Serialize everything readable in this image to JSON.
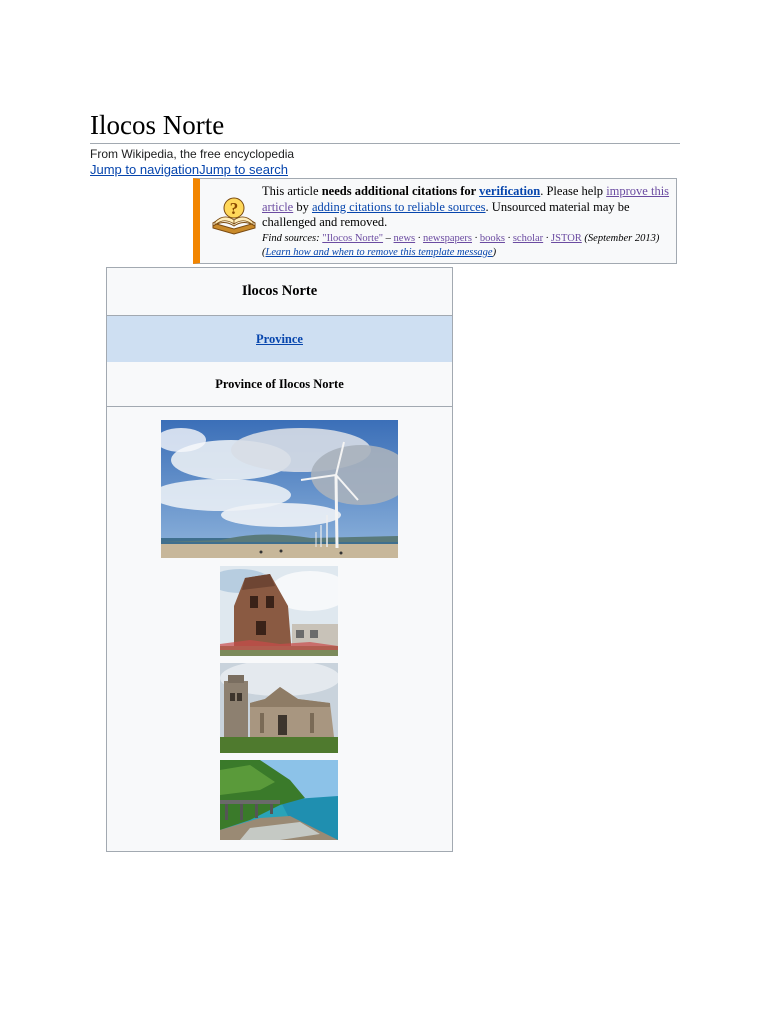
{
  "article": {
    "title": "Ilocos Norte",
    "tagline": "From Wikipedia, the free encyclopedia",
    "jump_navigation": "Jump to navigation",
    "jump_search": "Jump to search"
  },
  "notice": {
    "p1": "This article ",
    "bold1": "needs additional citations for ",
    "link_verification": "verification",
    "p2": ". Please help ",
    "link_improve": "improve this article",
    "p3": " by ",
    "link_adding": "adding citations to reliable sources",
    "p4": ". Unsourced material may be challenged and removed.",
    "find_sources_label": "Find sources: ",
    "link_query": "\"Ilocos Norte\"",
    "dash": " – ",
    "link_news": "news",
    "sep": " · ",
    "link_newspapers": "newspapers",
    "link_books": "books",
    "link_scholar": "scholar",
    "link_jstor": "JSTOR",
    "date": " (September 2013) (",
    "link_learn": "Learn how and when to remove this template message",
    "close_paren": ")",
    "icon": "question-book-icon"
  },
  "infobox": {
    "name": "Ilocos Norte",
    "type_link": "Province",
    "official_name": "Province of Ilocos Norte",
    "images": [
      "windmill-photo",
      "bell-tower-photo",
      "paoay-church-photo",
      "coastal-viaduct-photo"
    ]
  },
  "colors": {
    "link": "#0645ad",
    "visited": "#6b4ba1",
    "notice_border": "#f28500",
    "infobox_header": "#cedff2"
  }
}
